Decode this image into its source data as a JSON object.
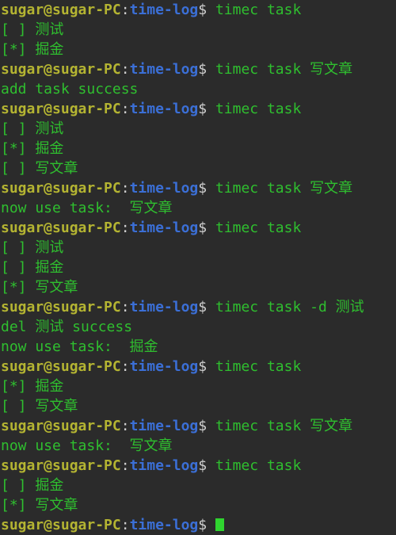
{
  "prompt": {
    "user_host": "sugar@sugar-PC",
    "colon": ":",
    "path": "time-log",
    "dollar": "$ "
  },
  "lines": [
    {
      "type": "prompt",
      "command": "timec task"
    },
    {
      "type": "output",
      "text": "[ ] 测试"
    },
    {
      "type": "output",
      "text": "[*] 掘金"
    },
    {
      "type": "prompt",
      "command": "timec task 写文章"
    },
    {
      "type": "output",
      "text": "add task success"
    },
    {
      "type": "prompt",
      "command": "timec task"
    },
    {
      "type": "output",
      "text": "[ ] 测试"
    },
    {
      "type": "output",
      "text": "[*] 掘金"
    },
    {
      "type": "output",
      "text": "[ ] 写文章"
    },
    {
      "type": "prompt",
      "command": "timec task 写文章"
    },
    {
      "type": "output",
      "text": "now use task:  写文章"
    },
    {
      "type": "prompt",
      "command": "timec task"
    },
    {
      "type": "output",
      "text": "[ ] 测试"
    },
    {
      "type": "output",
      "text": "[ ] 掘金"
    },
    {
      "type": "output",
      "text": "[*] 写文章"
    },
    {
      "type": "prompt",
      "command": "timec task -d 测试"
    },
    {
      "type": "output",
      "text": "del 测试 success"
    },
    {
      "type": "output",
      "text": "now use task:  掘金"
    },
    {
      "type": "prompt",
      "command": "timec task"
    },
    {
      "type": "output",
      "text": "[*] 掘金"
    },
    {
      "type": "output",
      "text": "[ ] 写文章"
    },
    {
      "type": "prompt",
      "command": "timec task 写文章"
    },
    {
      "type": "output",
      "text": "now use task:  写文章"
    },
    {
      "type": "prompt",
      "command": "timec task"
    },
    {
      "type": "output",
      "text": "[ ] 掘金"
    },
    {
      "type": "output",
      "text": "[*] 写文章"
    },
    {
      "type": "prompt",
      "command": "",
      "cursor": true
    }
  ],
  "colors": {
    "background": "#2b2b2b",
    "user_host": "#b4b432",
    "path": "#3b6fd6",
    "text": "#2fbf2f",
    "cursor": "#2fd42f"
  }
}
